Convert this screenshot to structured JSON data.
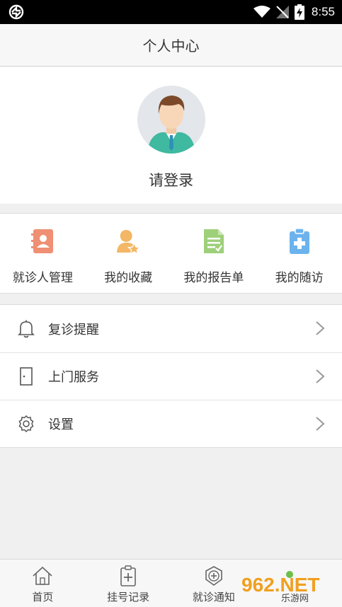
{
  "status_bar": {
    "time": "8:55"
  },
  "header": {
    "title": "个人中心"
  },
  "profile": {
    "login_text": "请登录"
  },
  "quick_actions": [
    {
      "label": "就诊人管理",
      "icon": "patient-card-icon",
      "color": "#ef8f74"
    },
    {
      "label": "我的收藏",
      "icon": "user-star-icon",
      "color": "#f3b766"
    },
    {
      "label": "我的报告单",
      "icon": "report-document-icon",
      "color": "#9ed07a"
    },
    {
      "label": "我的随访",
      "icon": "clipboard-plus-icon",
      "color": "#6cb3ee"
    }
  ],
  "menu": [
    {
      "label": "复诊提醒",
      "icon": "bell-icon"
    },
    {
      "label": "上门服务",
      "icon": "door-icon"
    },
    {
      "label": "设置",
      "icon": "gear-icon"
    }
  ],
  "tabbar": [
    {
      "label": "首页",
      "icon": "home-icon"
    },
    {
      "label": "挂号记录",
      "icon": "clipboard-plus-icon"
    },
    {
      "label": "就诊通知",
      "icon": "notice-plus-icon"
    }
  ],
  "watermark": {
    "text": "962.NET",
    "subtext": "乐游网"
  }
}
